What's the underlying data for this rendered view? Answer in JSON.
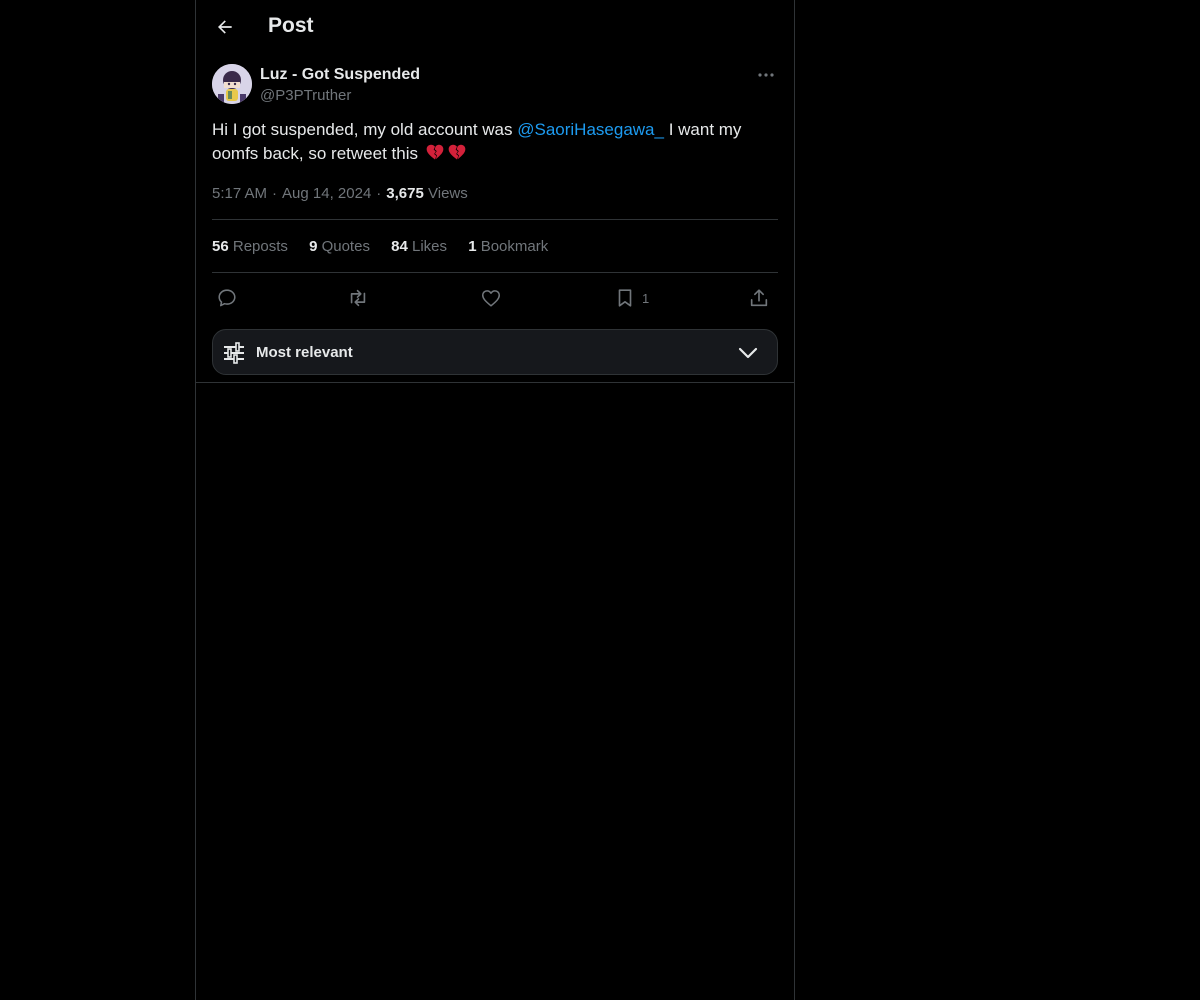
{
  "header": {
    "title": "Post"
  },
  "post": {
    "author_name": "Luz - Got Suspended",
    "author_handle": "@P3PTruther",
    "text_before": "Hi I got suspended, my old account was ",
    "mention": "@SaoriHasegawa_",
    "text_after": " I want my oomfs back, so retweet this",
    "emojis": [
      "broken-heart-icon",
      "broken-heart-icon"
    ],
    "time": "5:17 AM",
    "date": "Aug 14, 2024",
    "views_count": "3,675",
    "views_label": "Views"
  },
  "stats": {
    "reposts_count": "56",
    "reposts_label": "Reposts",
    "quotes_count": "9",
    "quotes_label": "Quotes",
    "likes_count": "84",
    "likes_label": "Likes",
    "bookmarks_count": "1",
    "bookmarks_label": "Bookmark"
  },
  "actions": {
    "reply_icon": "reply-icon",
    "repost_icon": "repost-icon",
    "like_icon": "heart-icon",
    "bookmark_icon": "bookmark-icon",
    "bookmark_count": "1",
    "share_icon": "share-icon"
  },
  "sort": {
    "label": "Most relevant",
    "icon": "sliders-icon",
    "chevron": "chevron-down-icon"
  },
  "colors": {
    "background": "#000000",
    "text": "#e7e9ea",
    "secondary": "#71767b",
    "accent": "#1d9bf0",
    "border": "#2f3336",
    "emoji": "#d3213a"
  }
}
